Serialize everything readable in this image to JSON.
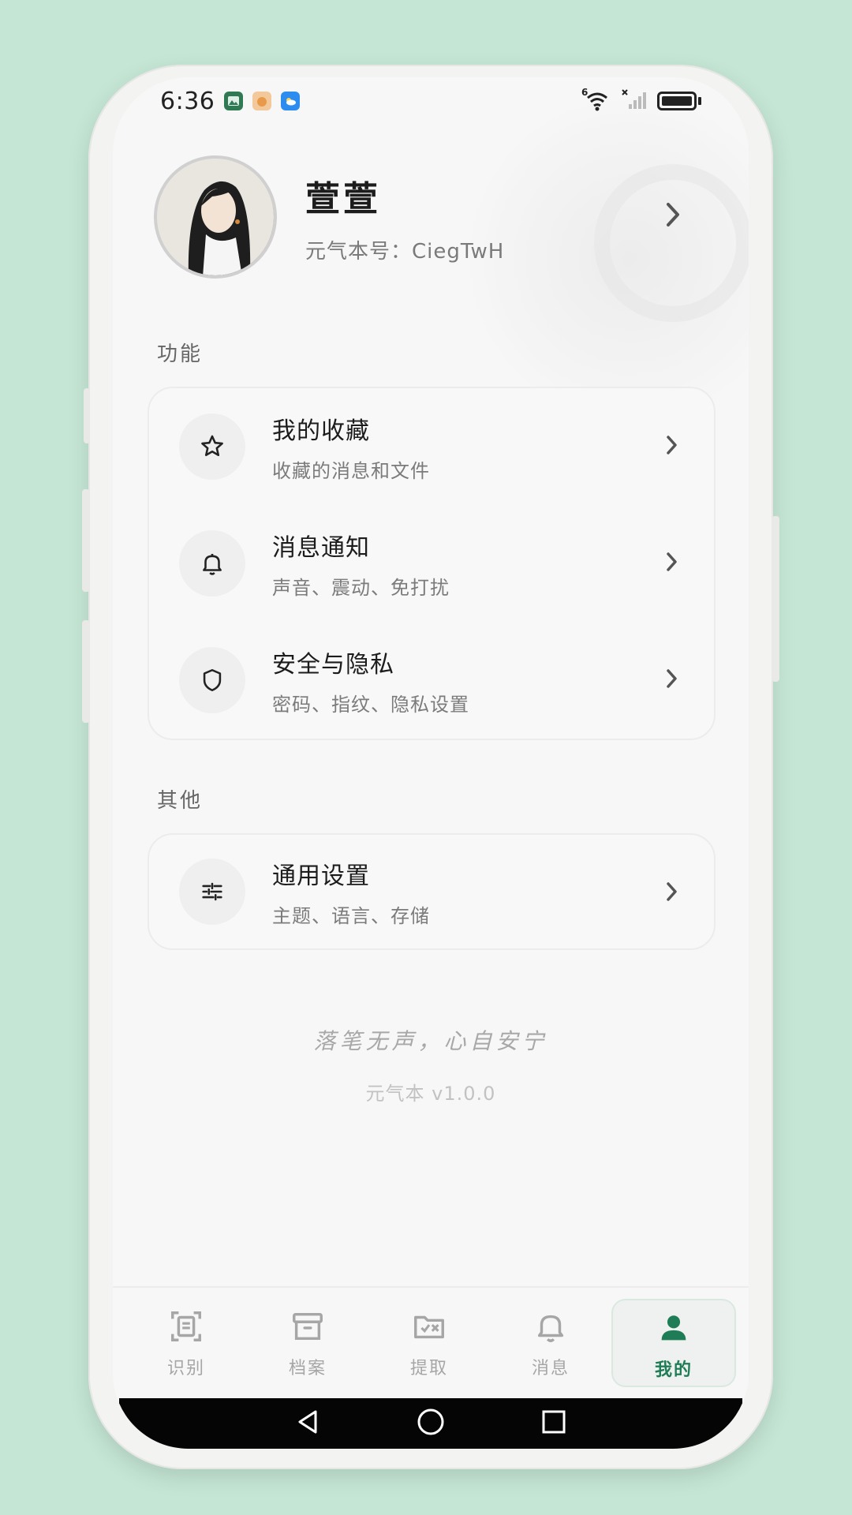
{
  "status_bar": {
    "time": "6:36",
    "network_label": "6"
  },
  "profile": {
    "nickname": "萱萱",
    "account": "元气本号：CiegTwH"
  },
  "sections": {
    "features_title": "功能",
    "others_title": "其他"
  },
  "feature_items": [
    {
      "title": "我的收藏",
      "subtitle": "收藏的消息和文件",
      "icon": "star-icon"
    },
    {
      "title": "消息通知",
      "subtitle": "声音、震动、免打扰",
      "icon": "bell-icon"
    },
    {
      "title": "安全与隐私",
      "subtitle": "密码、指纹、隐私设置",
      "icon": "shield-icon"
    }
  ],
  "other_items": [
    {
      "title": "通用设置",
      "subtitle": "主题、语言、存储",
      "icon": "sliders-icon"
    }
  ],
  "footer": {
    "motto": "落笔无声，心自安宁",
    "version": "元气本 v1.0.0"
  },
  "tabs": [
    {
      "label": "识别",
      "icon": "scan-icon",
      "active": false
    },
    {
      "label": "档案",
      "icon": "archive-icon",
      "active": false
    },
    {
      "label": "提取",
      "icon": "folder-extract-icon",
      "active": false
    },
    {
      "label": "消息",
      "icon": "bell-icon",
      "active": false
    },
    {
      "label": "我的",
      "icon": "user-icon",
      "active": true
    }
  ],
  "colors": {
    "accent": "#1e7d56",
    "background": "#c5e6d5",
    "screen": "#f7f7f7"
  }
}
